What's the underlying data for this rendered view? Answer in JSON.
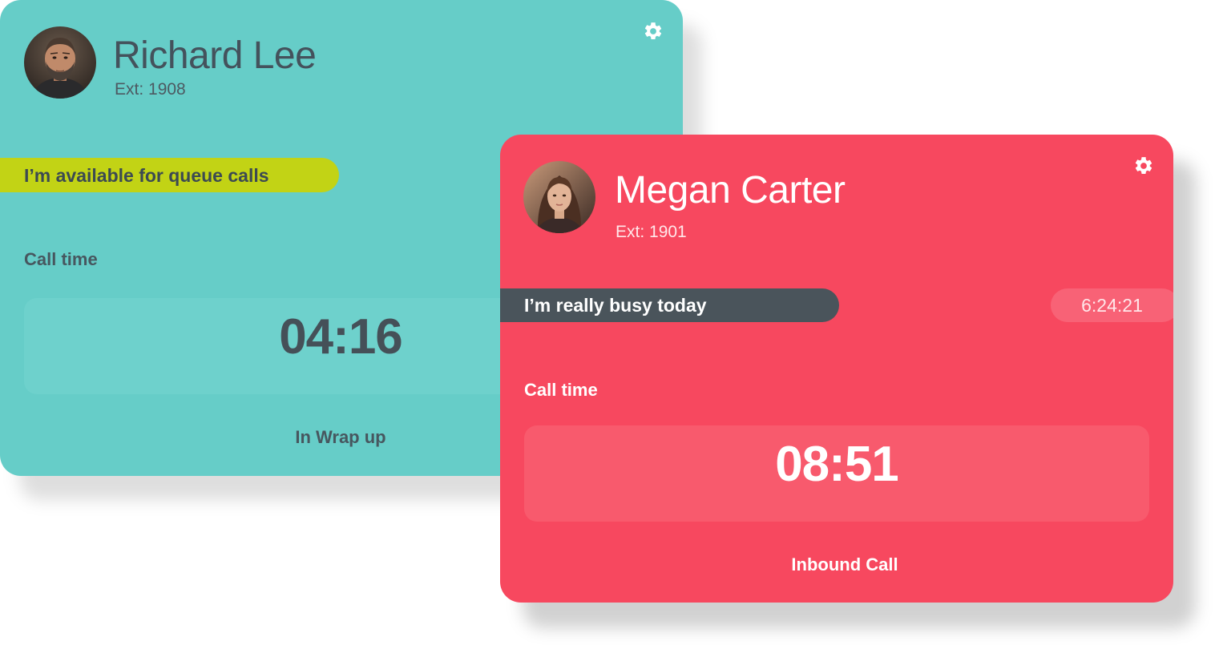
{
  "cards": {
    "richard": {
      "name": "Richard Lee",
      "ext": "Ext: 1908",
      "status": "I’m available for queue calls",
      "call_time_label": "Call time",
      "timer": "04:16",
      "state": "In Wrap up",
      "icons": {
        "settings": "gear-icon",
        "avatar": "avatar-photo"
      },
      "colors": {
        "background": "#66cdc8",
        "status_pill": "#c2d315",
        "text": "#44525c"
      }
    },
    "megan": {
      "name": "Megan Carter",
      "ext": "Ext: 1901",
      "status": "I’m really busy today",
      "status_duration": "6:24:21",
      "call_time_label": "Call time",
      "timer": "08:51",
      "state": "Inbound Call",
      "icons": {
        "settings": "gear-icon",
        "avatar": "avatar-photo"
      },
      "colors": {
        "background": "#f7485f",
        "status_pill": "#4a545b",
        "text": "#ffffff"
      }
    }
  }
}
